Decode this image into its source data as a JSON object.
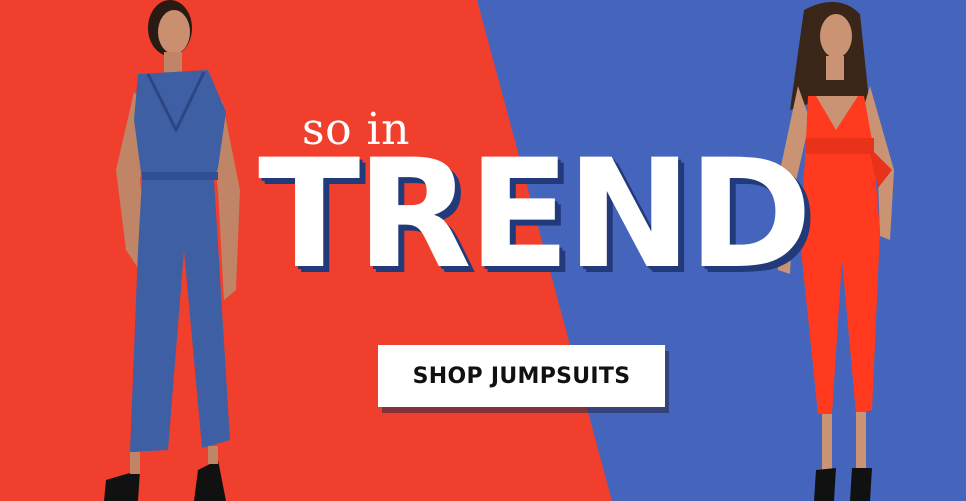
{
  "banner": {
    "kicker": "so in",
    "headline": "TREND",
    "cta_label": "SHOP JUMPSUITS"
  },
  "colors": {
    "left_bg": "#f03f2c",
    "right_bg": "#4565bd",
    "headline_shadow": "#233a7a",
    "left_jumpsuit": "#3e5fa3",
    "right_jumpsuit": "#ff3a1e"
  }
}
